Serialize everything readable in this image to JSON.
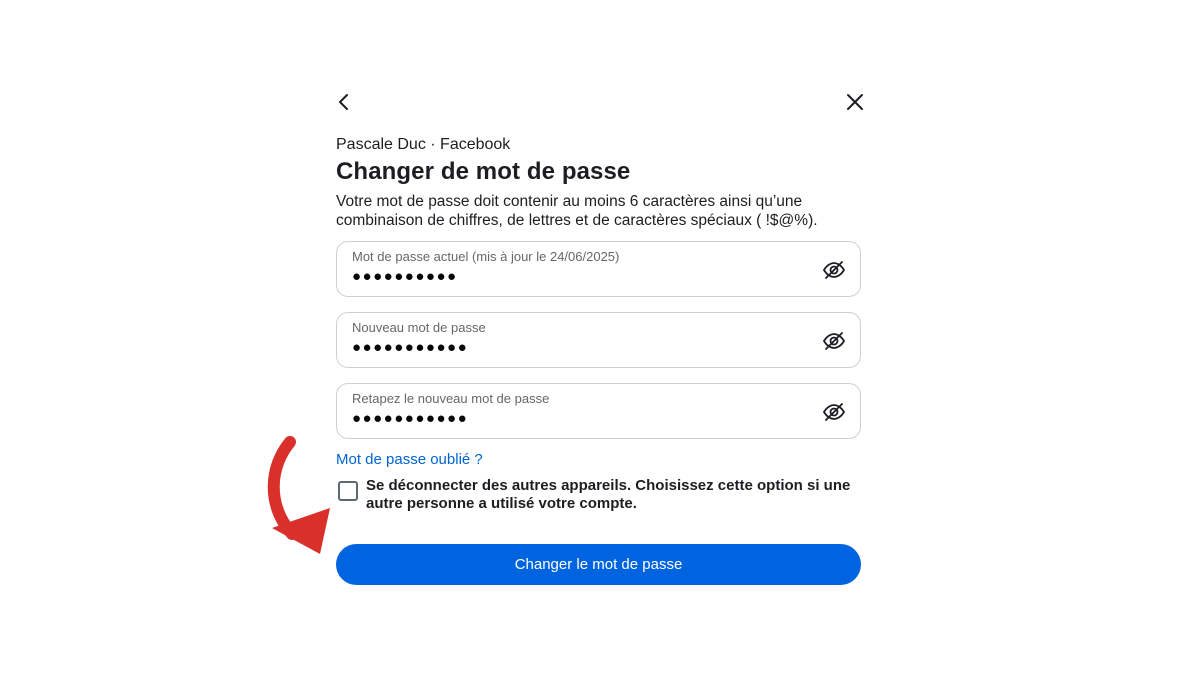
{
  "header": {
    "back_icon": "chevron-left-icon",
    "close_icon": "close-icon"
  },
  "account": {
    "line": "Pascale Duc · Facebook"
  },
  "page": {
    "title": "Changer de mot de passe",
    "description": "Votre mot de passe doit contenir au moins 6 caractères ainsi qu’une combinaison de chiffres, de lettres et de caractères spéciaux ( !$@%)."
  },
  "fields": [
    {
      "label": "Mot de passe actuel (mis à jour le 24/06/2025)",
      "value": "●●●●●●●●●●",
      "icon": "eye-off-icon"
    },
    {
      "label": "Nouveau mot de passe",
      "value": "●●●●●●●●●●●",
      "icon": "eye-off-icon"
    },
    {
      "label": "Retapez le nouveau mot de passe",
      "value": "●●●●●●●●●●●",
      "icon": "eye-off-icon"
    }
  ],
  "forgot_link": "Mot de passe oublié ?",
  "logout_option": {
    "label": "Se déconnecter des autres appareils. Choisissez cette option si une autre personne a utilisé votre compte.",
    "checked": false
  },
  "submit": {
    "label": "Changer le mot de passe"
  },
  "colors": {
    "primary": "#0064e0",
    "link": "#0064d1",
    "annotation_arrow": "#d9302b"
  }
}
